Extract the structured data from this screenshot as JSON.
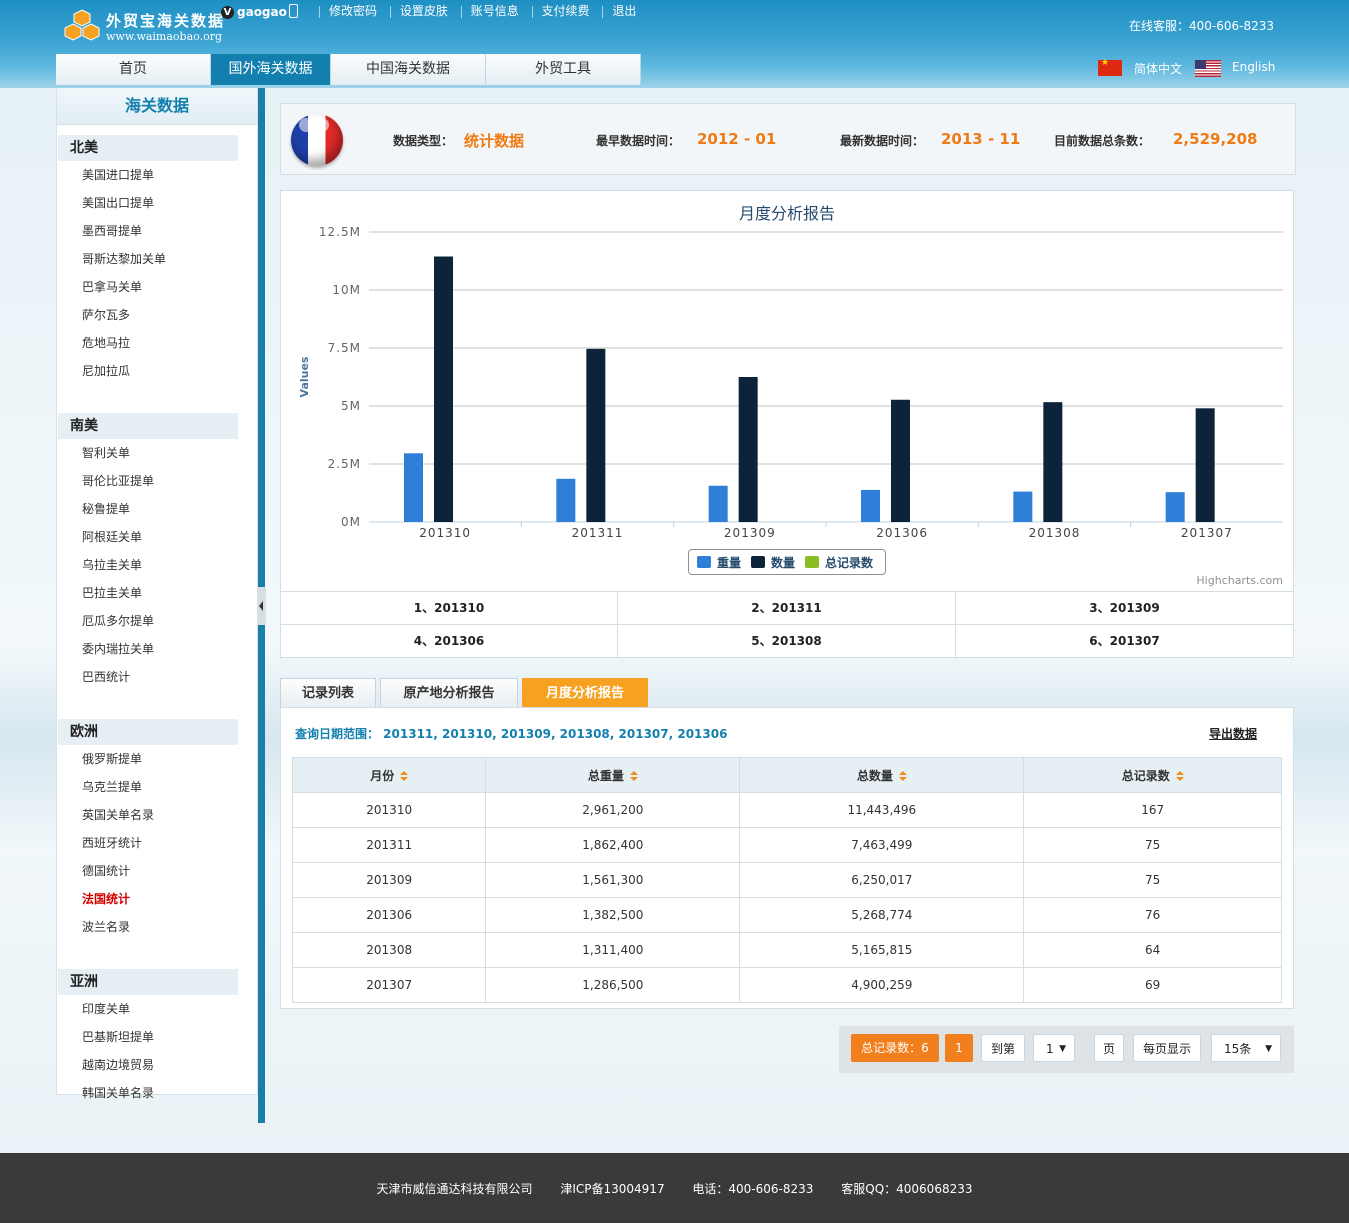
{
  "header": {
    "logo_title": "外贸宝海关数据",
    "logo_url": "www.waimaobao.org",
    "user_badge": "V",
    "username": "gaogao",
    "links": [
      "修改密码",
      "设置皮肤",
      "账号信息",
      "支付续费",
      "退出"
    ],
    "hotline": "在线客服：400-606-8233",
    "lang_cn": "简体中文",
    "lang_en": "English"
  },
  "nav": [
    "首页",
    "国外海关数据",
    "中国海关数据",
    "外贸工具"
  ],
  "sidebar": {
    "title": "海关数据",
    "regions": [
      {
        "name": "北美",
        "items": [
          "美国进口提单",
          "美国出口提单",
          "墨西哥提单",
          "哥斯达黎加关单",
          "巴拿马关单",
          "萨尔瓦多",
          "危地马拉",
          "尼加拉瓜"
        ]
      },
      {
        "name": "南美",
        "items": [
          "智利关单",
          "哥伦比亚提单",
          "秘鲁提单",
          "阿根廷关单",
          "乌拉圭关单",
          "巴拉圭关单",
          "厄瓜多尔提单",
          "委内瑞拉关单",
          "巴西统计"
        ]
      },
      {
        "name": "欧洲",
        "items": [
          "俄罗斯提单",
          "乌克兰提单",
          "英国关单名录",
          "西班牙统计",
          "德国统计",
          "法国统计",
          "波兰名录"
        ]
      },
      {
        "name": "亚洲",
        "items": [
          "印度关单",
          "巴基斯坦提单",
          "越南边境贸易",
          "韩国关单名录"
        ]
      }
    ],
    "active_item": "法国统计"
  },
  "info": {
    "type_label": "数据类型：",
    "type_value": "统计数据",
    "earliest_label": "最早数据时间：",
    "earliest_value": "2012 - 01",
    "latest_label": "最新数据时间：",
    "latest_value": "2013 - 11",
    "total_label": "目前数据总条数：",
    "total_value": "2,529,208"
  },
  "chart_data": {
    "type": "bar",
    "title": "月度分析报告",
    "ylabel": "Values",
    "xlabel": "",
    "categories": [
      "201310",
      "201311",
      "201309",
      "201306",
      "201308",
      "201307"
    ],
    "ylim": [
      0,
      12500000
    ],
    "yticks": [
      "0M",
      "2.5M",
      "5M",
      "7.5M",
      "10M",
      "12.5M"
    ],
    "series": [
      {
        "name": "重量",
        "color": "#2f7ed8",
        "values": [
          2961200,
          1862400,
          1561300,
          1382500,
          1311400,
          1286500
        ]
      },
      {
        "name": "数量",
        "color": "#0d233a",
        "values": [
          11443496,
          7463499,
          6250017,
          5268774,
          5165815,
          4900259
        ]
      },
      {
        "name": "总记录数",
        "color": "#8bbc21",
        "values": [
          167,
          75,
          75,
          76,
          64,
          69
        ]
      }
    ],
    "legend": "bottom-center",
    "grid": true,
    "credits": "Highcharts.com"
  },
  "periods": [
    "1、201310",
    "2、201311",
    "3、201309",
    "4、201306",
    "5、201308",
    "6、201307"
  ],
  "tabs": [
    "记录列表",
    "原产地分析报告",
    "月度分析报告"
  ],
  "table": {
    "query_range": "查询日期范围： 201311, 201310, 201309, 201308, 201307, 201306",
    "export_label": "导出数据",
    "headers": [
      "月份",
      "总重量",
      "总数量",
      "总记录数"
    ],
    "rows": [
      [
        "201310",
        "2,961,200",
        "11,443,496",
        "167"
      ],
      [
        "201311",
        "1,862,400",
        "7,463,499",
        "75"
      ],
      [
        "201309",
        "1,561,300",
        "6,250,017",
        "75"
      ],
      [
        "201306",
        "1,382,500",
        "5,268,774",
        "76"
      ],
      [
        "201308",
        "1,311,400",
        "5,165,815",
        "64"
      ],
      [
        "201307",
        "1,286,500",
        "4,900,259",
        "69"
      ]
    ]
  },
  "pager": {
    "total": "总记录数：6",
    "current": "1",
    "goto_label": "到第",
    "page_select": "1",
    "page_label": "页",
    "per_page_label": "每页显示",
    "per_page_select": "15条"
  },
  "footer": {
    "company": "天津市威信通达科技有限公司",
    "icp": "津ICP备13004917",
    "phone": "电话：400-606-8233",
    "qq": "客服QQ：4006068233"
  }
}
